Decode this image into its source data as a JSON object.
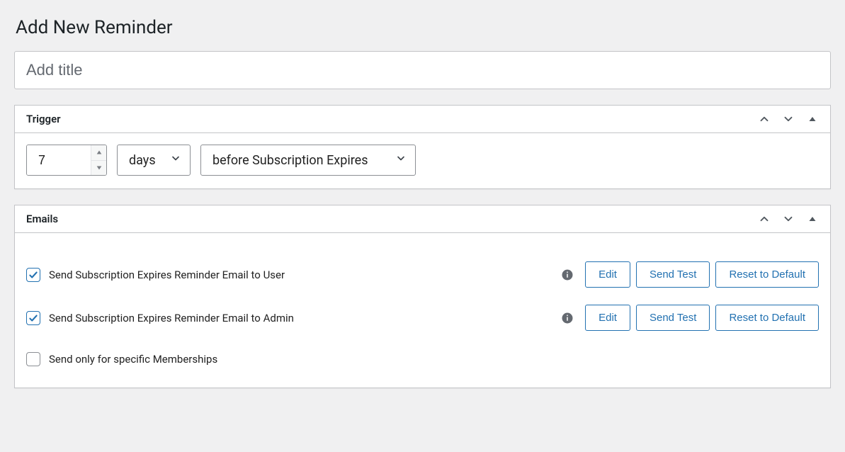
{
  "page": {
    "title": "Add New Reminder"
  },
  "title_field": {
    "placeholder": "Add title",
    "value": ""
  },
  "panels": {
    "trigger": {
      "title": "Trigger"
    },
    "emails": {
      "title": "Emails"
    }
  },
  "trigger": {
    "number": "7",
    "unit": "days",
    "condition": "before Subscription Expires"
  },
  "emails": {
    "rows": [
      {
        "checked": true,
        "label": "Send Subscription Expires Reminder Email to User"
      },
      {
        "checked": true,
        "label": "Send Subscription Expires Reminder Email to Admin"
      }
    ],
    "buttons": {
      "edit": "Edit",
      "send_test": "Send Test",
      "reset": "Reset to Default"
    },
    "specific": {
      "checked": false,
      "label": "Send only for specific Memberships"
    }
  }
}
